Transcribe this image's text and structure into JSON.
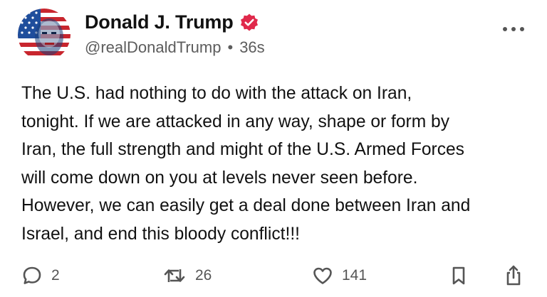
{
  "author": {
    "display_name": "Donald J. Trump",
    "handle": "@realDonaldTrump",
    "separator": "•",
    "time_ago": "36s",
    "verified_icon": "verified-badge-icon",
    "avatar": "flag-portrait-avatar"
  },
  "post": {
    "text": "The U.S. had nothing to do with the attack on Iran,\ntonight. If we are attacked in any way, shape or form by\nIran, the full strength and might of the U.S. Armed Forces\nwill come down on you at levels never seen before.\nHowever, we can easily get a deal done between Iran and\nIsrael, and end this bloody conflict!!!"
  },
  "actions": {
    "replies": {
      "icon": "reply-icon",
      "count": "2"
    },
    "retruths": {
      "icon": "retruth-icon",
      "count": "26"
    },
    "likes": {
      "icon": "heart-icon",
      "count": "141"
    },
    "bookmark": {
      "icon": "bookmark-icon"
    },
    "share": {
      "icon": "share-icon"
    }
  },
  "colors": {
    "verified": "#e0294b",
    "text": "#111111",
    "muted": "#5c5c5c",
    "icon": "#555555"
  }
}
